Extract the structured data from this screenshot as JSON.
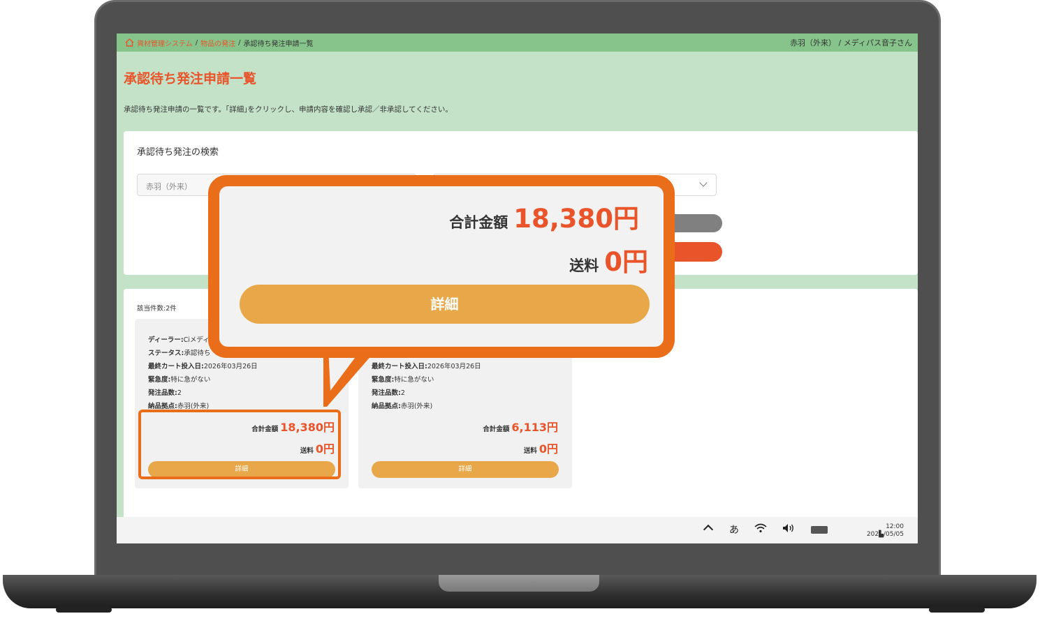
{
  "breadcrumb": {
    "home": "資材管理システム",
    "parent": "物品の発注",
    "current": "承認待ち発注申請一覧"
  },
  "user": {
    "name": "赤羽（外来） /  メディパス音子さん"
  },
  "page": {
    "title": "承認待ち発注申請一覧",
    "description": "承認待ち発注申請の一覧です。｢詳細｣をクリックし、申請内容を確認し承認／非承認してください。"
  },
  "search": {
    "title": "承認待ち発注の検索",
    "location_value": "赤羽（外来）"
  },
  "results": {
    "count": "該当件数:2件",
    "cards": [
      {
        "dealer_label": "ディーラー:",
        "dealer": "Ciメディ",
        "status_label": "ステータス:",
        "status": "承認待ち",
        "last_cart_label": "最終カート投入日:",
        "last_cart": "2026年03月26日",
        "urgency_label": "緊急度:",
        "urgency": "特に急がない",
        "items_label": "発注品数:",
        "items": "2",
        "delivery_label": "納品拠点:",
        "delivery": "赤羽(外来)",
        "total_label": "合計金額",
        "total": "18,380円",
        "shipping_label": "送料",
        "shipping": "0円",
        "detail_label": "詳細"
      },
      {
        "last_cart_label": "最終カート投入日:",
        "last_cart": "2026年03月26日",
        "urgency_label": "緊急度:",
        "urgency": "特に急がない",
        "items_label": "発注品数:",
        "items": "2",
        "delivery_label": "納品拠点:",
        "delivery": "赤羽(外来)",
        "total_label": "合計金額",
        "total": "6,113円",
        "shipping_label": "送料",
        "shipping": "0円",
        "detail_label": "詳細"
      }
    ]
  },
  "callout": {
    "total_label": "合計金額",
    "total": "18,380円",
    "shipping_label": "送料",
    "shipping": "0円",
    "detail_label": "詳細"
  },
  "taskbar": {
    "ime": "あ",
    "time": "12:00",
    "date": "202▙/05/05"
  },
  "colors": {
    "accent": "#e9542a",
    "callout_border": "#ea6e1a",
    "header_green": "#86c48c",
    "page_green": "#c4e2c7",
    "detail_button": "#e8a84a"
  },
  "icons": [
    "home-icon",
    "chevron-down-icon",
    "caret-up-icon",
    "wifi-icon",
    "speaker-icon",
    "battery-icon"
  ]
}
